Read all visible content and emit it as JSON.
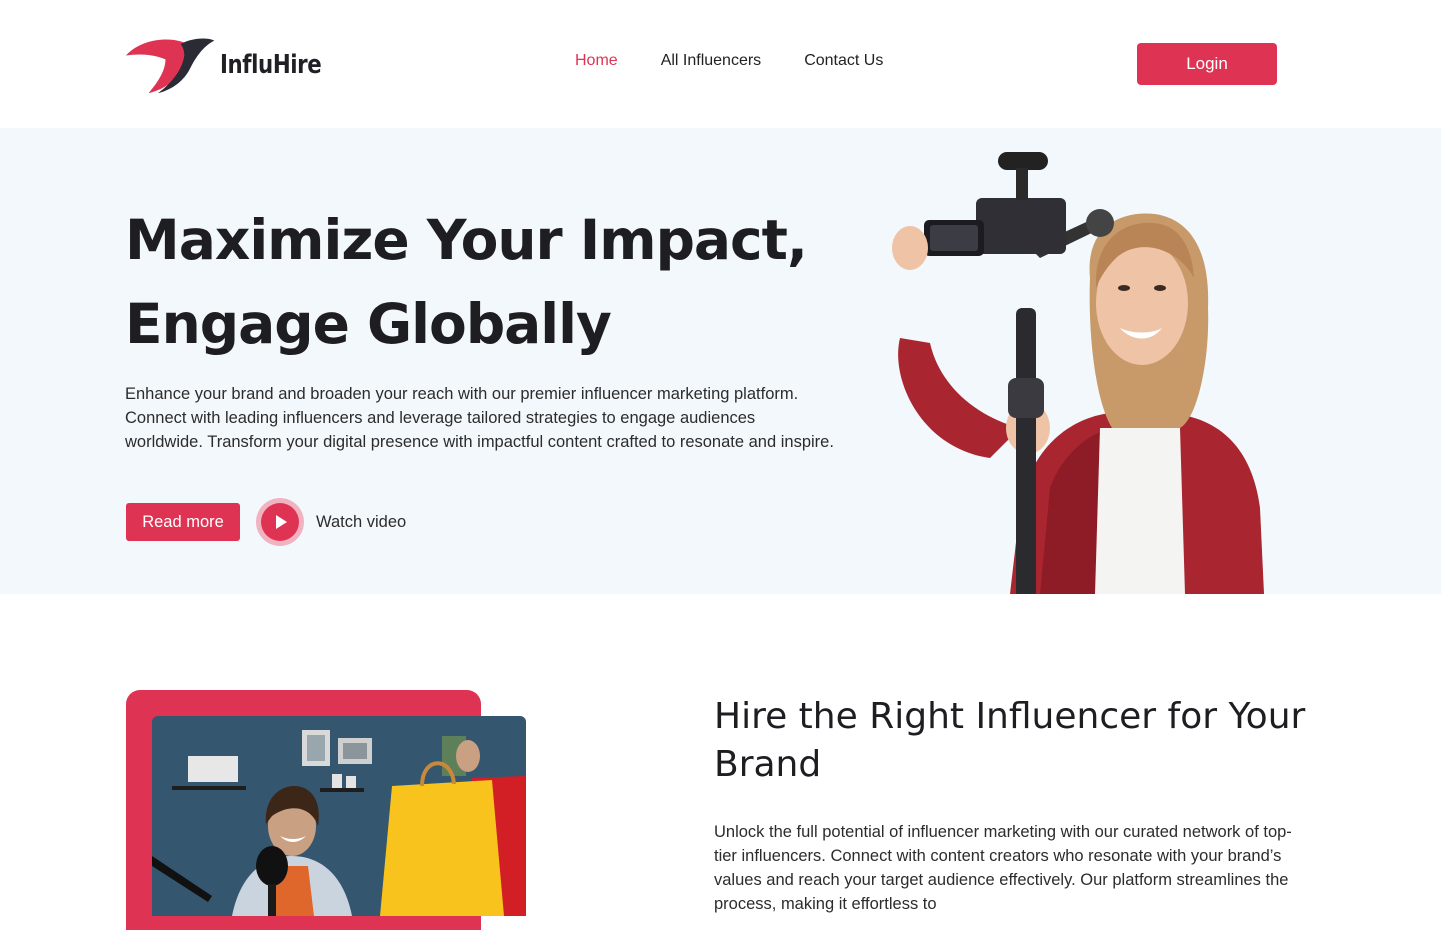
{
  "brand": {
    "name": "InfluHire",
    "accent": "#df3354"
  },
  "nav": {
    "items": [
      {
        "label": "Home",
        "active": true
      },
      {
        "label": "All Influencers",
        "active": false
      },
      {
        "label": "Contact Us",
        "active": false
      }
    ],
    "login_label": "Login"
  },
  "hero": {
    "title_line1": "Maximize Your Impact,",
    "title_line2": "Engage Globally",
    "description": "Enhance your brand and broaden your reach with our premier influencer marketing platform. Connect with leading influencers and leverage tailored strategies to engage audiences worldwide. Transform your digital presence with impactful content crafted to resonate and inspire.",
    "read_more_label": "Read more",
    "watch_video_label": "Watch video"
  },
  "section2": {
    "title": "Hire the Right Influencer for Your Brand",
    "description": "Unlock the full potential of influencer marketing with our curated network of top-tier influencers. Connect with content creators who resonate with your brand’s values and reach your target audience effectively. Our platform streamlines the process, making it effortless to"
  }
}
